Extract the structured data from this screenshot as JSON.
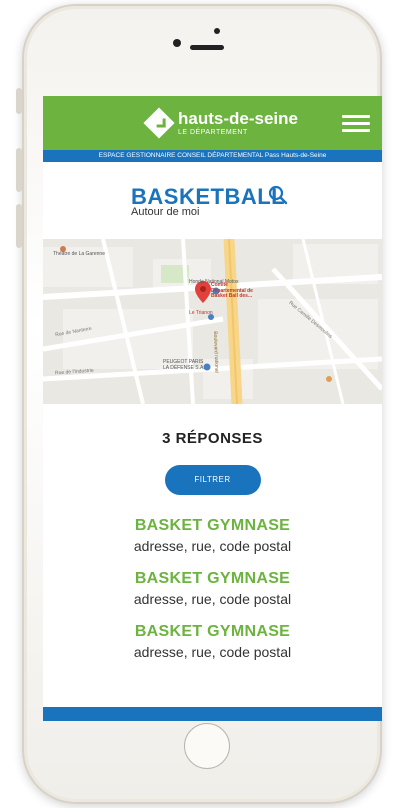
{
  "header": {
    "logo_name": "hauts-de-seine",
    "logo_sub": "LE DÉPARTEMENT",
    "banner": "ESPACE GESTIONNAIRE CONSEIL DÉPARTEMENTAL Pass Hauts-de-Seine"
  },
  "page": {
    "title": "BASKETBALL",
    "subtitle": "Autour de moi"
  },
  "map": {
    "labels": [
      "Théâtre de La Garenne",
      "Honda National Motos",
      "Comité Départemental de Basket Ball des...",
      "Le Trianon",
      "PEUGEOT PARIS LA DÉFENSE S.A.",
      "Boulevard national",
      "Rue de Nanterre",
      "Rue de l'Industrie",
      "Rue Camille Desmoulins"
    ]
  },
  "results": {
    "count_label": "3 RÉPONSES",
    "filter_label": "FILTRER",
    "items": [
      {
        "name": "BASKET GYMNASE",
        "address": "adresse, rue, code postal"
      },
      {
        "name": "BASKET GYMNASE",
        "address": "adresse, rue, code postal"
      },
      {
        "name": "BASKET GYMNASE",
        "address": "adresse, rue, code postal"
      }
    ]
  },
  "colors": {
    "green": "#6cb33f",
    "blue": "#1a73bd"
  }
}
